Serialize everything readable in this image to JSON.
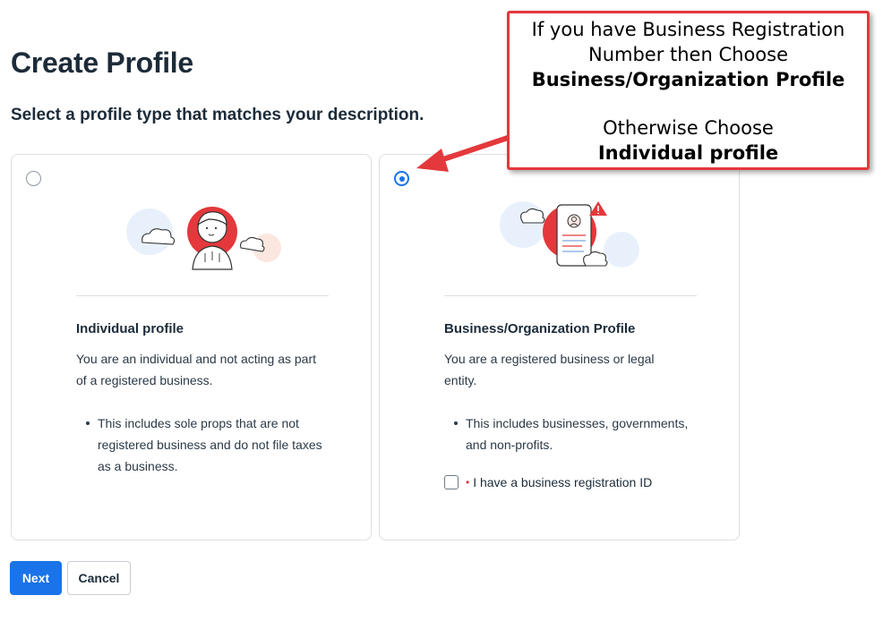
{
  "page": {
    "title": "Create Profile",
    "subtitle": "Select a profile type that matches your description."
  },
  "cards": {
    "individual": {
      "selected": false,
      "title": "Individual profile",
      "description": "You are an individual and not acting as part of a registered business.",
      "bullets": [
        "This includes sole props that are not registered business and do not file taxes as a business."
      ]
    },
    "business": {
      "selected": true,
      "title": "Business/Organization Profile",
      "description": "You are a registered business or legal entity.",
      "bullets": [
        "This includes businesses, governments, and non-profits."
      ],
      "checkbox_label": "I have a business registration ID",
      "checkbox_checked": false
    }
  },
  "buttons": {
    "next": "Next",
    "cancel": "Cancel"
  },
  "callout": {
    "line1": "If you have Business Registration",
    "line2": "Number then Choose",
    "line3": "Business/Organization Profile",
    "line4": "Otherwise Choose",
    "line5": "Individual profile"
  },
  "colors": {
    "primary": "#1a73e8",
    "accent_red": "#e4383c",
    "text": "#1c2b39",
    "border": "#dcdfe4"
  }
}
